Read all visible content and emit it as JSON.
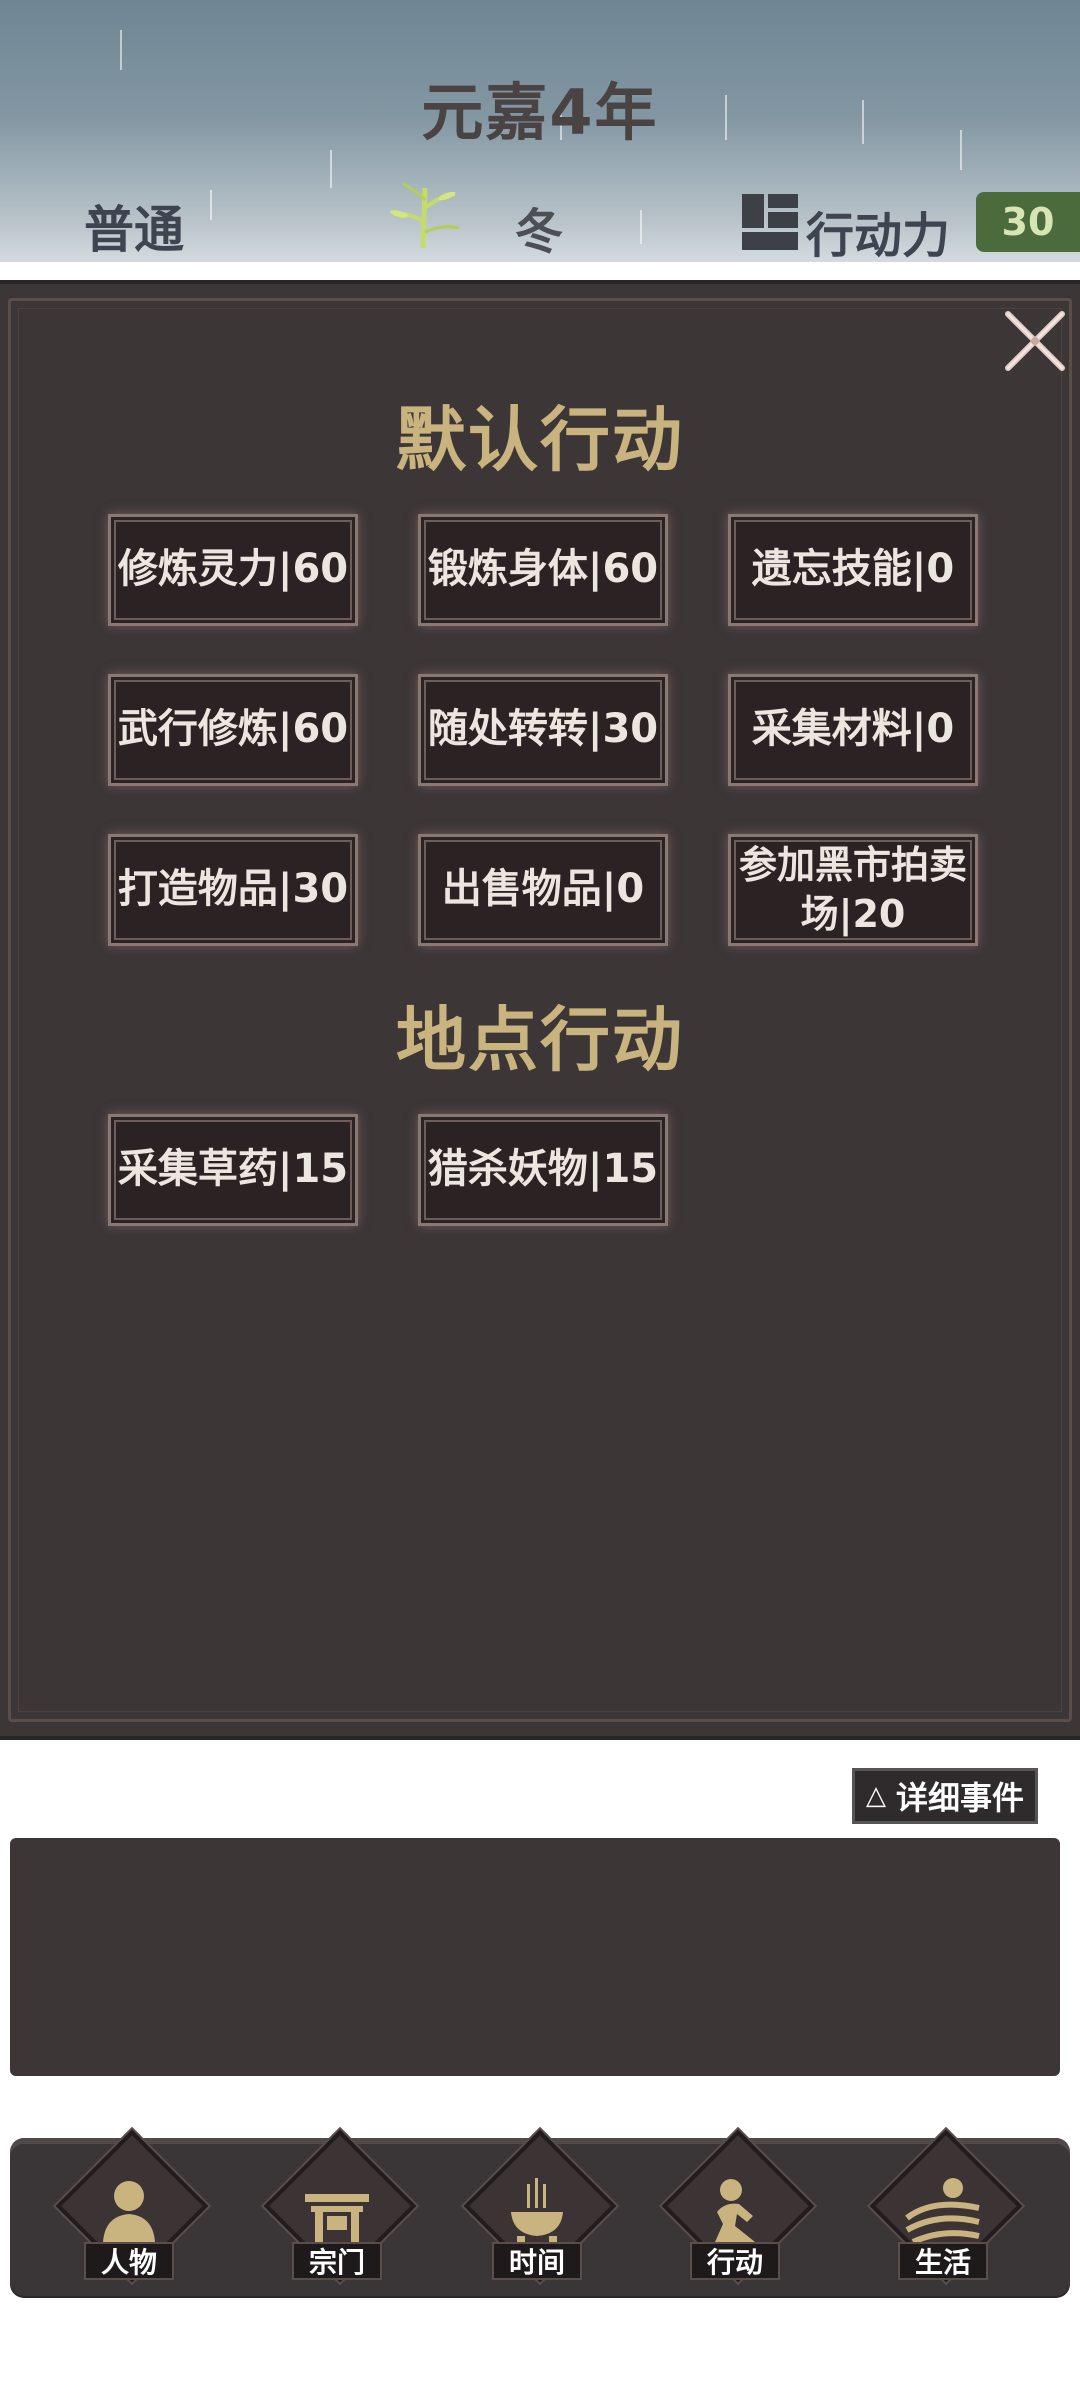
{
  "header": {
    "year_title": "元嘉4年",
    "difficulty": "普通",
    "season": "冬",
    "action_power_label": "行动力",
    "action_power_value": "30",
    "icons": [
      "bamboo-icon",
      "action-power-icon"
    ]
  },
  "panel": {
    "default_title": "默认行动",
    "location_title": "地点行动",
    "close_icon": "close-icon",
    "default_actions": [
      {
        "label": "修炼灵力|60"
      },
      {
        "label": "锻炼身体|60"
      },
      {
        "label": "遗忘技能|0"
      },
      {
        "label": "武行修炼|60"
      },
      {
        "label": "随处转转|30"
      },
      {
        "label": "采集材料|0"
      },
      {
        "label": "打造物品|30"
      },
      {
        "label": "出售物品|0"
      },
      {
        "label": "参加黑市拍卖场|20"
      }
    ],
    "location_actions": [
      {
        "label": "采集草药|15"
      },
      {
        "label": "猎杀妖物|15"
      }
    ]
  },
  "events": {
    "detail_button_label": "详细事件",
    "detail_button_icon": "△"
  },
  "nav": {
    "items": [
      {
        "label": "人物",
        "icon": "person-icon"
      },
      {
        "label": "宗门",
        "icon": "sect-gate-icon"
      },
      {
        "label": "时间",
        "icon": "incense-burner-icon"
      },
      {
        "label": "行动",
        "icon": "action-figure-icon"
      },
      {
        "label": "生活",
        "icon": "landscape-icon"
      }
    ]
  },
  "colors": {
    "panel_bg": "#3c3637",
    "title_gold": "#c9b37f",
    "action_power_badge": "#4c6b3c"
  }
}
